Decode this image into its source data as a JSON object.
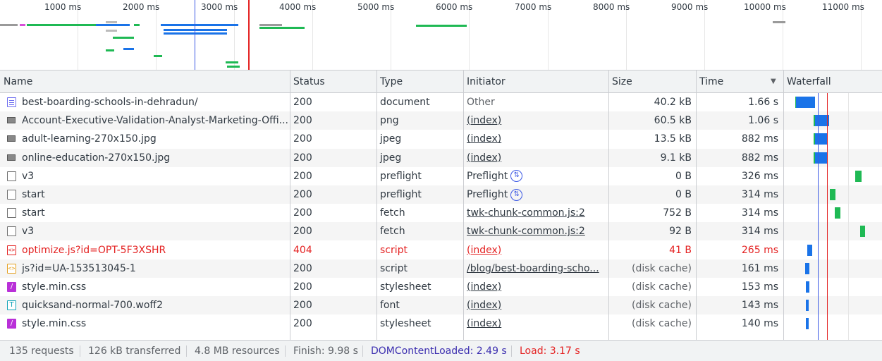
{
  "overview": {
    "ticks": [
      "1000 ms",
      "2000 ms",
      "3000 ms",
      "4000 ms",
      "5000 ms",
      "6000 ms",
      "7000 ms",
      "8000 ms",
      "9000 ms",
      "10000 ms",
      "11000 ms"
    ]
  },
  "columns": {
    "name": "Name",
    "status": "Status",
    "type": "Type",
    "initiator": "Initiator",
    "size": "Size",
    "time": "Time",
    "sort_indicator": "▼",
    "waterfall": "Waterfall"
  },
  "rows": [
    {
      "icon": "document-icon",
      "name": "best-boarding-schools-in-dehradun/",
      "status": "200",
      "type": "document",
      "initiator": "Other",
      "size": "40.2 kB",
      "time": "1.66 s"
    },
    {
      "icon": "image-icon",
      "name": "Account-Executive-Validation-Analyst-Marketing-Offi...",
      "status": "200",
      "type": "png",
      "initiator": "(index)",
      "size": "60.5 kB",
      "time": "1.06 s"
    },
    {
      "icon": "image-icon",
      "name": "adult-learning-270x150.jpg",
      "status": "200",
      "type": "jpeg",
      "initiator": "(index)",
      "size": "13.5 kB",
      "time": "882 ms"
    },
    {
      "icon": "image-icon",
      "name": "online-education-270x150.jpg",
      "status": "200",
      "type": "jpeg",
      "initiator": "(index)",
      "size": "9.1 kB",
      "time": "882 ms"
    },
    {
      "icon": "blank-icon",
      "name": "v3",
      "status": "200",
      "type": "preflight",
      "initiator": "Preflight",
      "size": "0 B",
      "time": "326 ms"
    },
    {
      "icon": "blank-icon",
      "name": "start",
      "status": "200",
      "type": "preflight",
      "initiator": "Preflight",
      "size": "0 B",
      "time": "314 ms"
    },
    {
      "icon": "blank-icon",
      "name": "start",
      "status": "200",
      "type": "fetch",
      "initiator": "twk-chunk-common.js:2",
      "size": "752 B",
      "time": "314 ms"
    },
    {
      "icon": "blank-icon",
      "name": "v3",
      "status": "200",
      "type": "fetch",
      "initiator": "twk-chunk-common.js:2",
      "size": "92 B",
      "time": "314 ms"
    },
    {
      "icon": "script-error-icon",
      "name": "optimize.js?id=OPT-5F3XSHR",
      "status": "404",
      "type": "script",
      "initiator": "(index)",
      "size": "41 B",
      "time": "265 ms"
    },
    {
      "icon": "script-icon",
      "name": "js?id=UA-153513045-1",
      "status": "200",
      "type": "script",
      "initiator": "/blog/best-boarding-scho...",
      "size": "(disk cache)",
      "time": "161 ms"
    },
    {
      "icon": "stylesheet-icon",
      "name": "style.min.css",
      "status": "200",
      "type": "stylesheet",
      "initiator": "(index)",
      "size": "(disk cache)",
      "time": "153 ms"
    },
    {
      "icon": "font-icon",
      "name": "quicksand-normal-700.woff2",
      "status": "200",
      "type": "font",
      "initiator": "(index)",
      "size": "(disk cache)",
      "time": "143 ms"
    },
    {
      "icon": "stylesheet-icon",
      "name": "style.min.css",
      "status": "200",
      "type": "stylesheet",
      "initiator": "(index)",
      "size": "(disk cache)",
      "time": "140 ms"
    }
  ],
  "status_bar": {
    "requests": "135 requests",
    "transferred": "126 kB transferred",
    "resources": "4.8 MB resources",
    "finish": "Finish: 9.98 s",
    "dom_content_loaded": "DOMContentLoaded: 2.49 s",
    "load": "Load: 3.17 s"
  },
  "colors": {
    "dcl_line": "#3c59e4",
    "load_line": "#e42222",
    "waiting": "#1fb954",
    "download": "#1a73e8",
    "error_text": "#e42222"
  }
}
